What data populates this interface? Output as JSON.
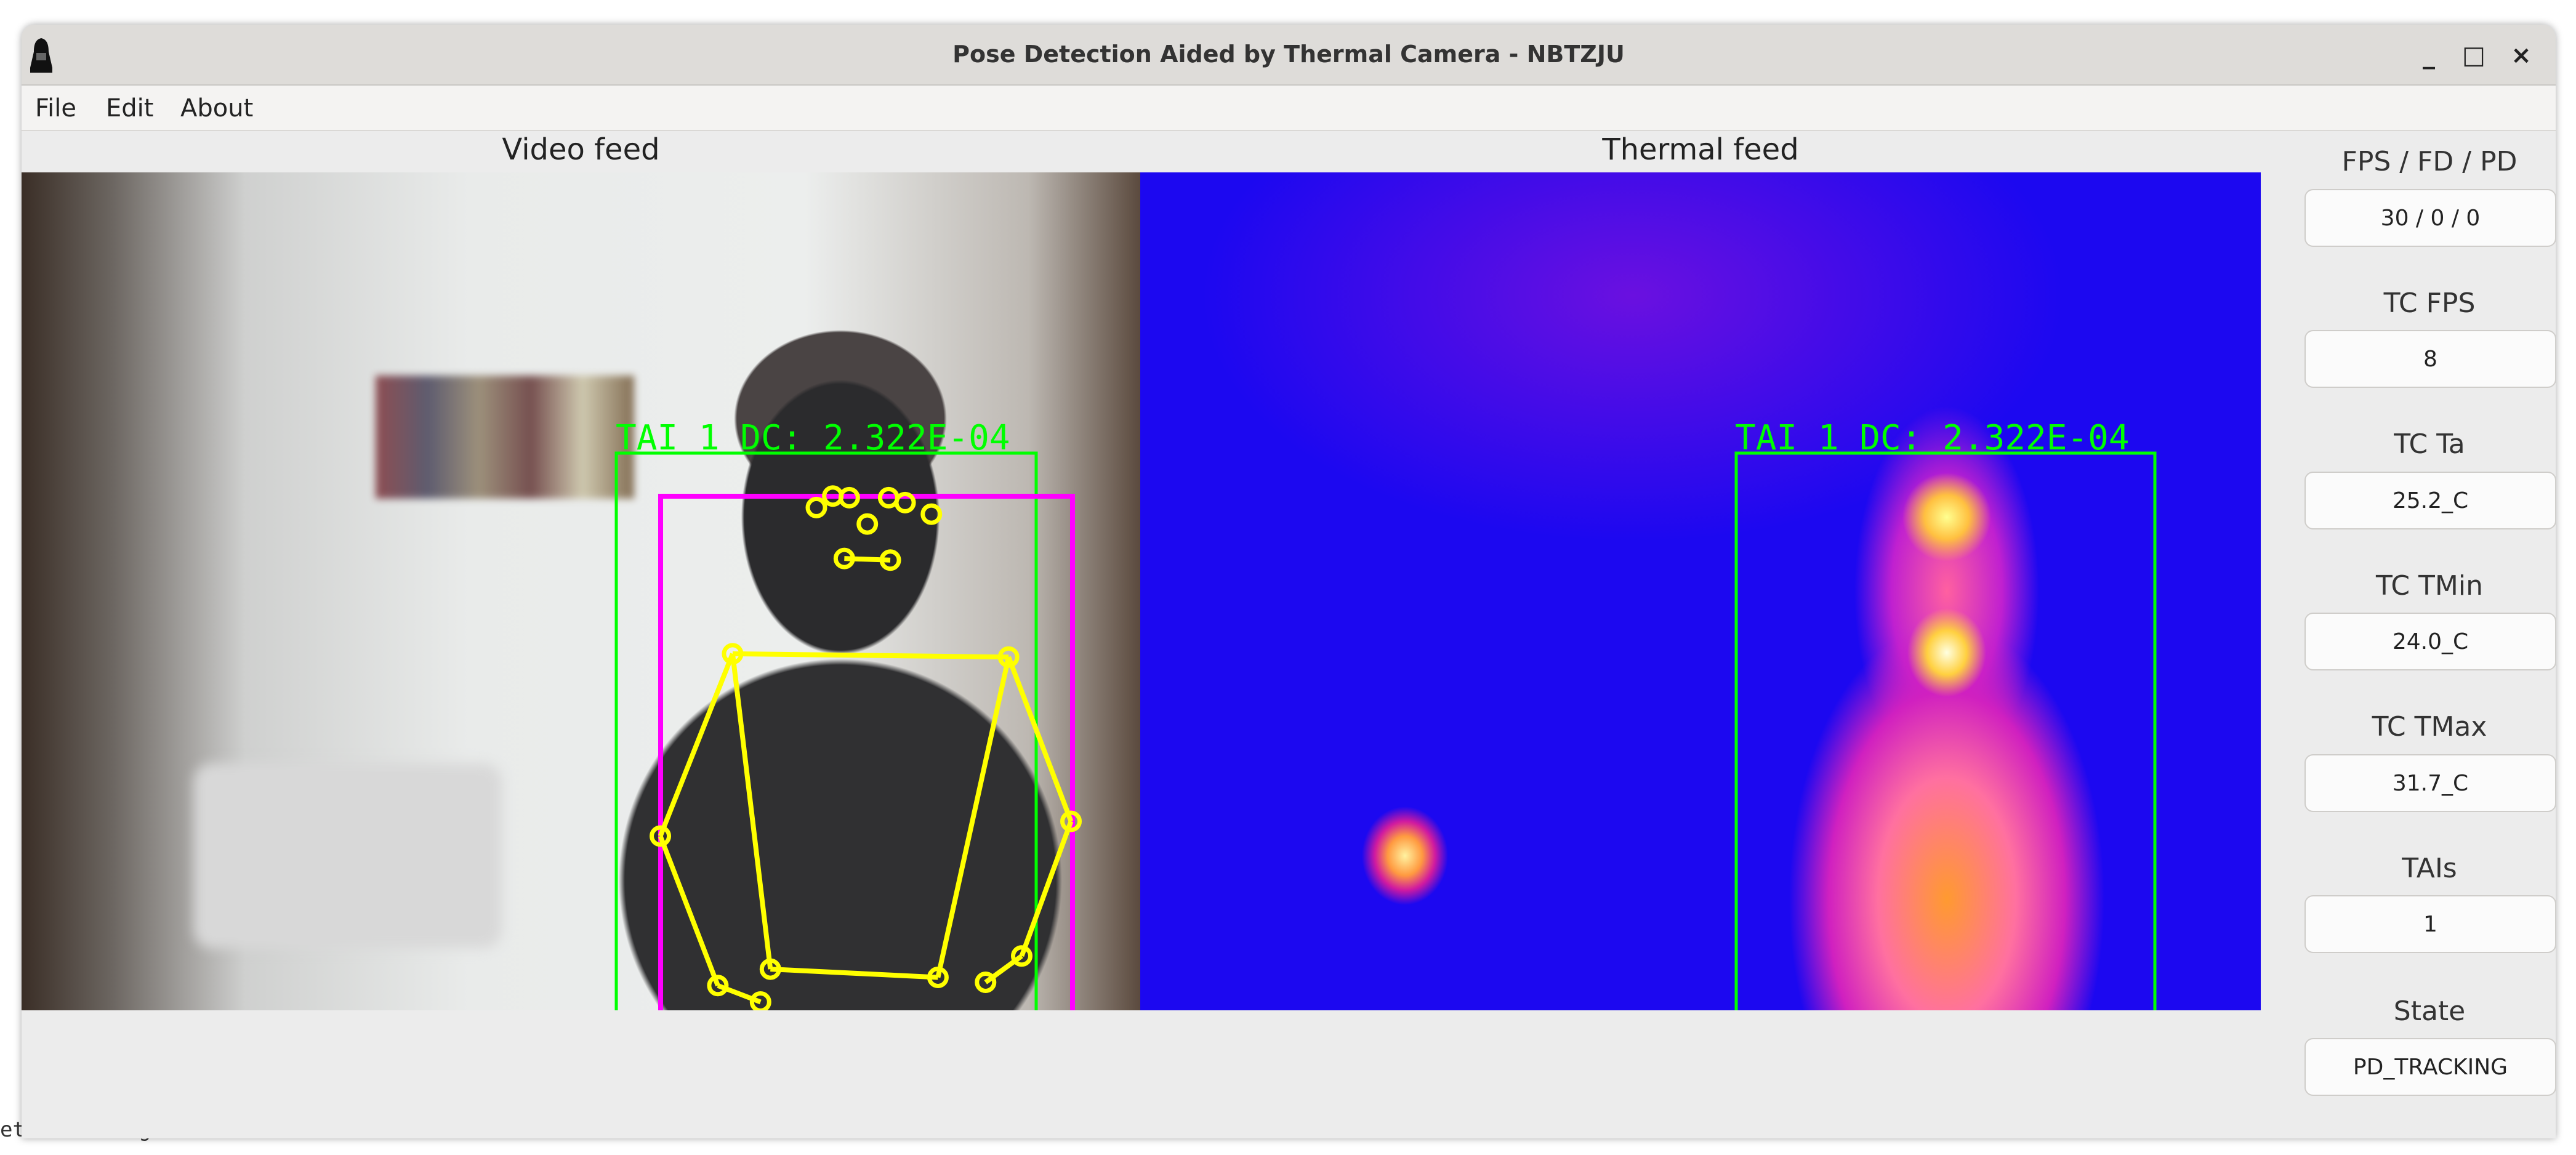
{
  "background": {
    "terminal_text": "etection algorithm thread"
  },
  "window": {
    "title": "Pose Detection Aided by Thermal Camera - NBTZJU",
    "buttons": {
      "minimize": "_",
      "maximize": "□",
      "close": "×"
    }
  },
  "menu": [
    "File",
    "Edit",
    "About"
  ],
  "feeds": {
    "video_label": "Video feed",
    "thermal_label": "Thermal feed",
    "video_overlay_text": "TAI 1 DC: 2.322E-04",
    "thermal_overlay_text": "TAI 1 DC: 2.322E-04"
  },
  "colors": {
    "detection_box": "#00ff00",
    "person_box": "#ff00ff",
    "skeleton": "#ffff00"
  },
  "panel": [
    {
      "label": "FPS / FD / PD",
      "value": "30 / 0 / 0"
    },
    {
      "label": "TC FPS",
      "value": "8"
    },
    {
      "label": "TC Ta",
      "value": "25.2_C"
    },
    {
      "label": "TC TMin",
      "value": "24.0_C"
    },
    {
      "label": "TC TMax",
      "value": "31.7_C"
    },
    {
      "label": "TAIs",
      "value": "1"
    },
    {
      "label": "State",
      "value": "PD_TRACKING"
    }
  ]
}
